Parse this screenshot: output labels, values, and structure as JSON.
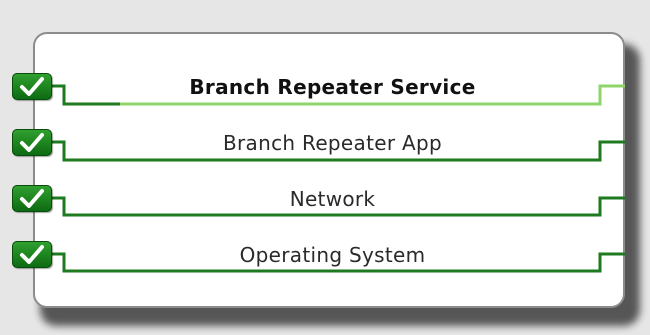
{
  "panel": {
    "rows": [
      {
        "label": "Branch Repeater Service",
        "status_icon": "check-icon",
        "primary": true
      },
      {
        "label": "Branch Repeater App",
        "status_icon": "check-icon",
        "primary": false
      },
      {
        "label": "Network",
        "status_icon": "check-icon",
        "primary": false
      },
      {
        "label": "Operating System",
        "status_icon": "check-icon",
        "primary": false
      }
    ]
  },
  "colors": {
    "line_dark_green": "#1e7a1e",
    "line_light_green": "#8ed46a",
    "badge_green": "#178a1a"
  }
}
